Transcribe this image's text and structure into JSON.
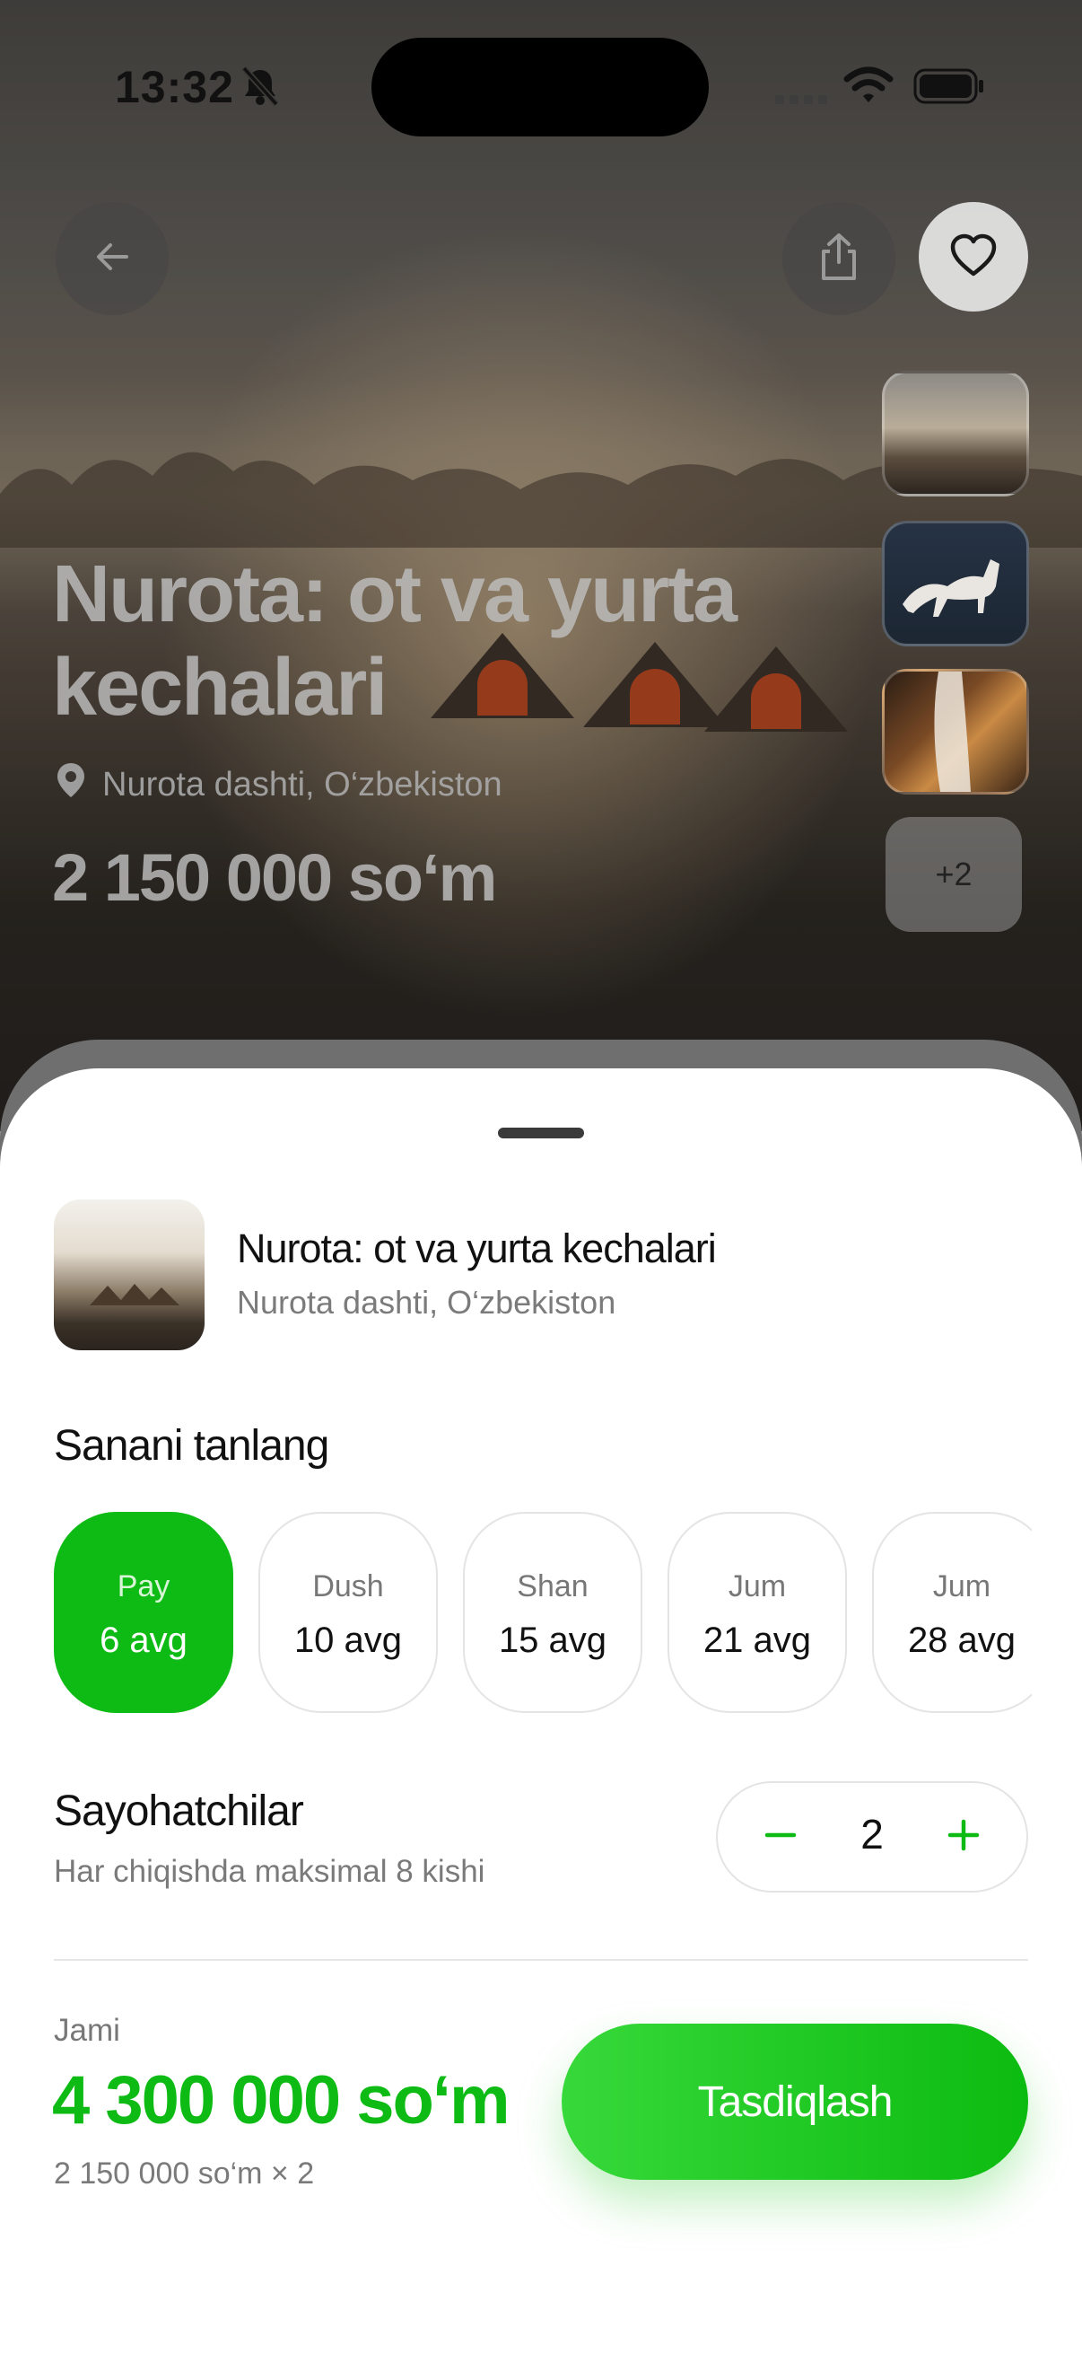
{
  "status_bar": {
    "time": "13:32"
  },
  "hero": {
    "title": "Nurota: ot va yurta kechalari",
    "location": "Nurota dashti, O‘zbekiston",
    "price": "2 150 000 so‘m",
    "more_photos": "+2"
  },
  "sheet": {
    "tour_title": "Nurota: ot va yurta kechalari",
    "tour_location": "Nurota dashti, O‘zbekiston",
    "date_section_title": "Sanani tanlang",
    "dates": [
      {
        "day": "Pay",
        "date": "6 avg",
        "selected": true
      },
      {
        "day": "Dush",
        "date": "10 avg",
        "selected": false
      },
      {
        "day": "Shan",
        "date": "15 avg",
        "selected": false
      },
      {
        "day": "Jum",
        "date": "21 avg",
        "selected": false
      },
      {
        "day": "Jum",
        "date": "28 avg",
        "selected": false
      }
    ],
    "travelers_title": "Sayohatchilar",
    "travelers_subtitle": "Har chiqishda maksimal 8 kishi",
    "travelers_count": "2",
    "total_label": "Jami",
    "total_value": "4 300 000 so‘m",
    "total_calc": "2 150 000 so‘m × 2",
    "confirm_label": "Tasdiqlash"
  },
  "colors": {
    "accent": "#0dbb14"
  },
  "icons": [
    "bell-slash-icon",
    "signal-icon",
    "wifi-icon",
    "battery-icon",
    "back-arrow-icon",
    "share-icon",
    "heart-icon",
    "location-pin-icon",
    "minus-icon",
    "plus-icon"
  ]
}
